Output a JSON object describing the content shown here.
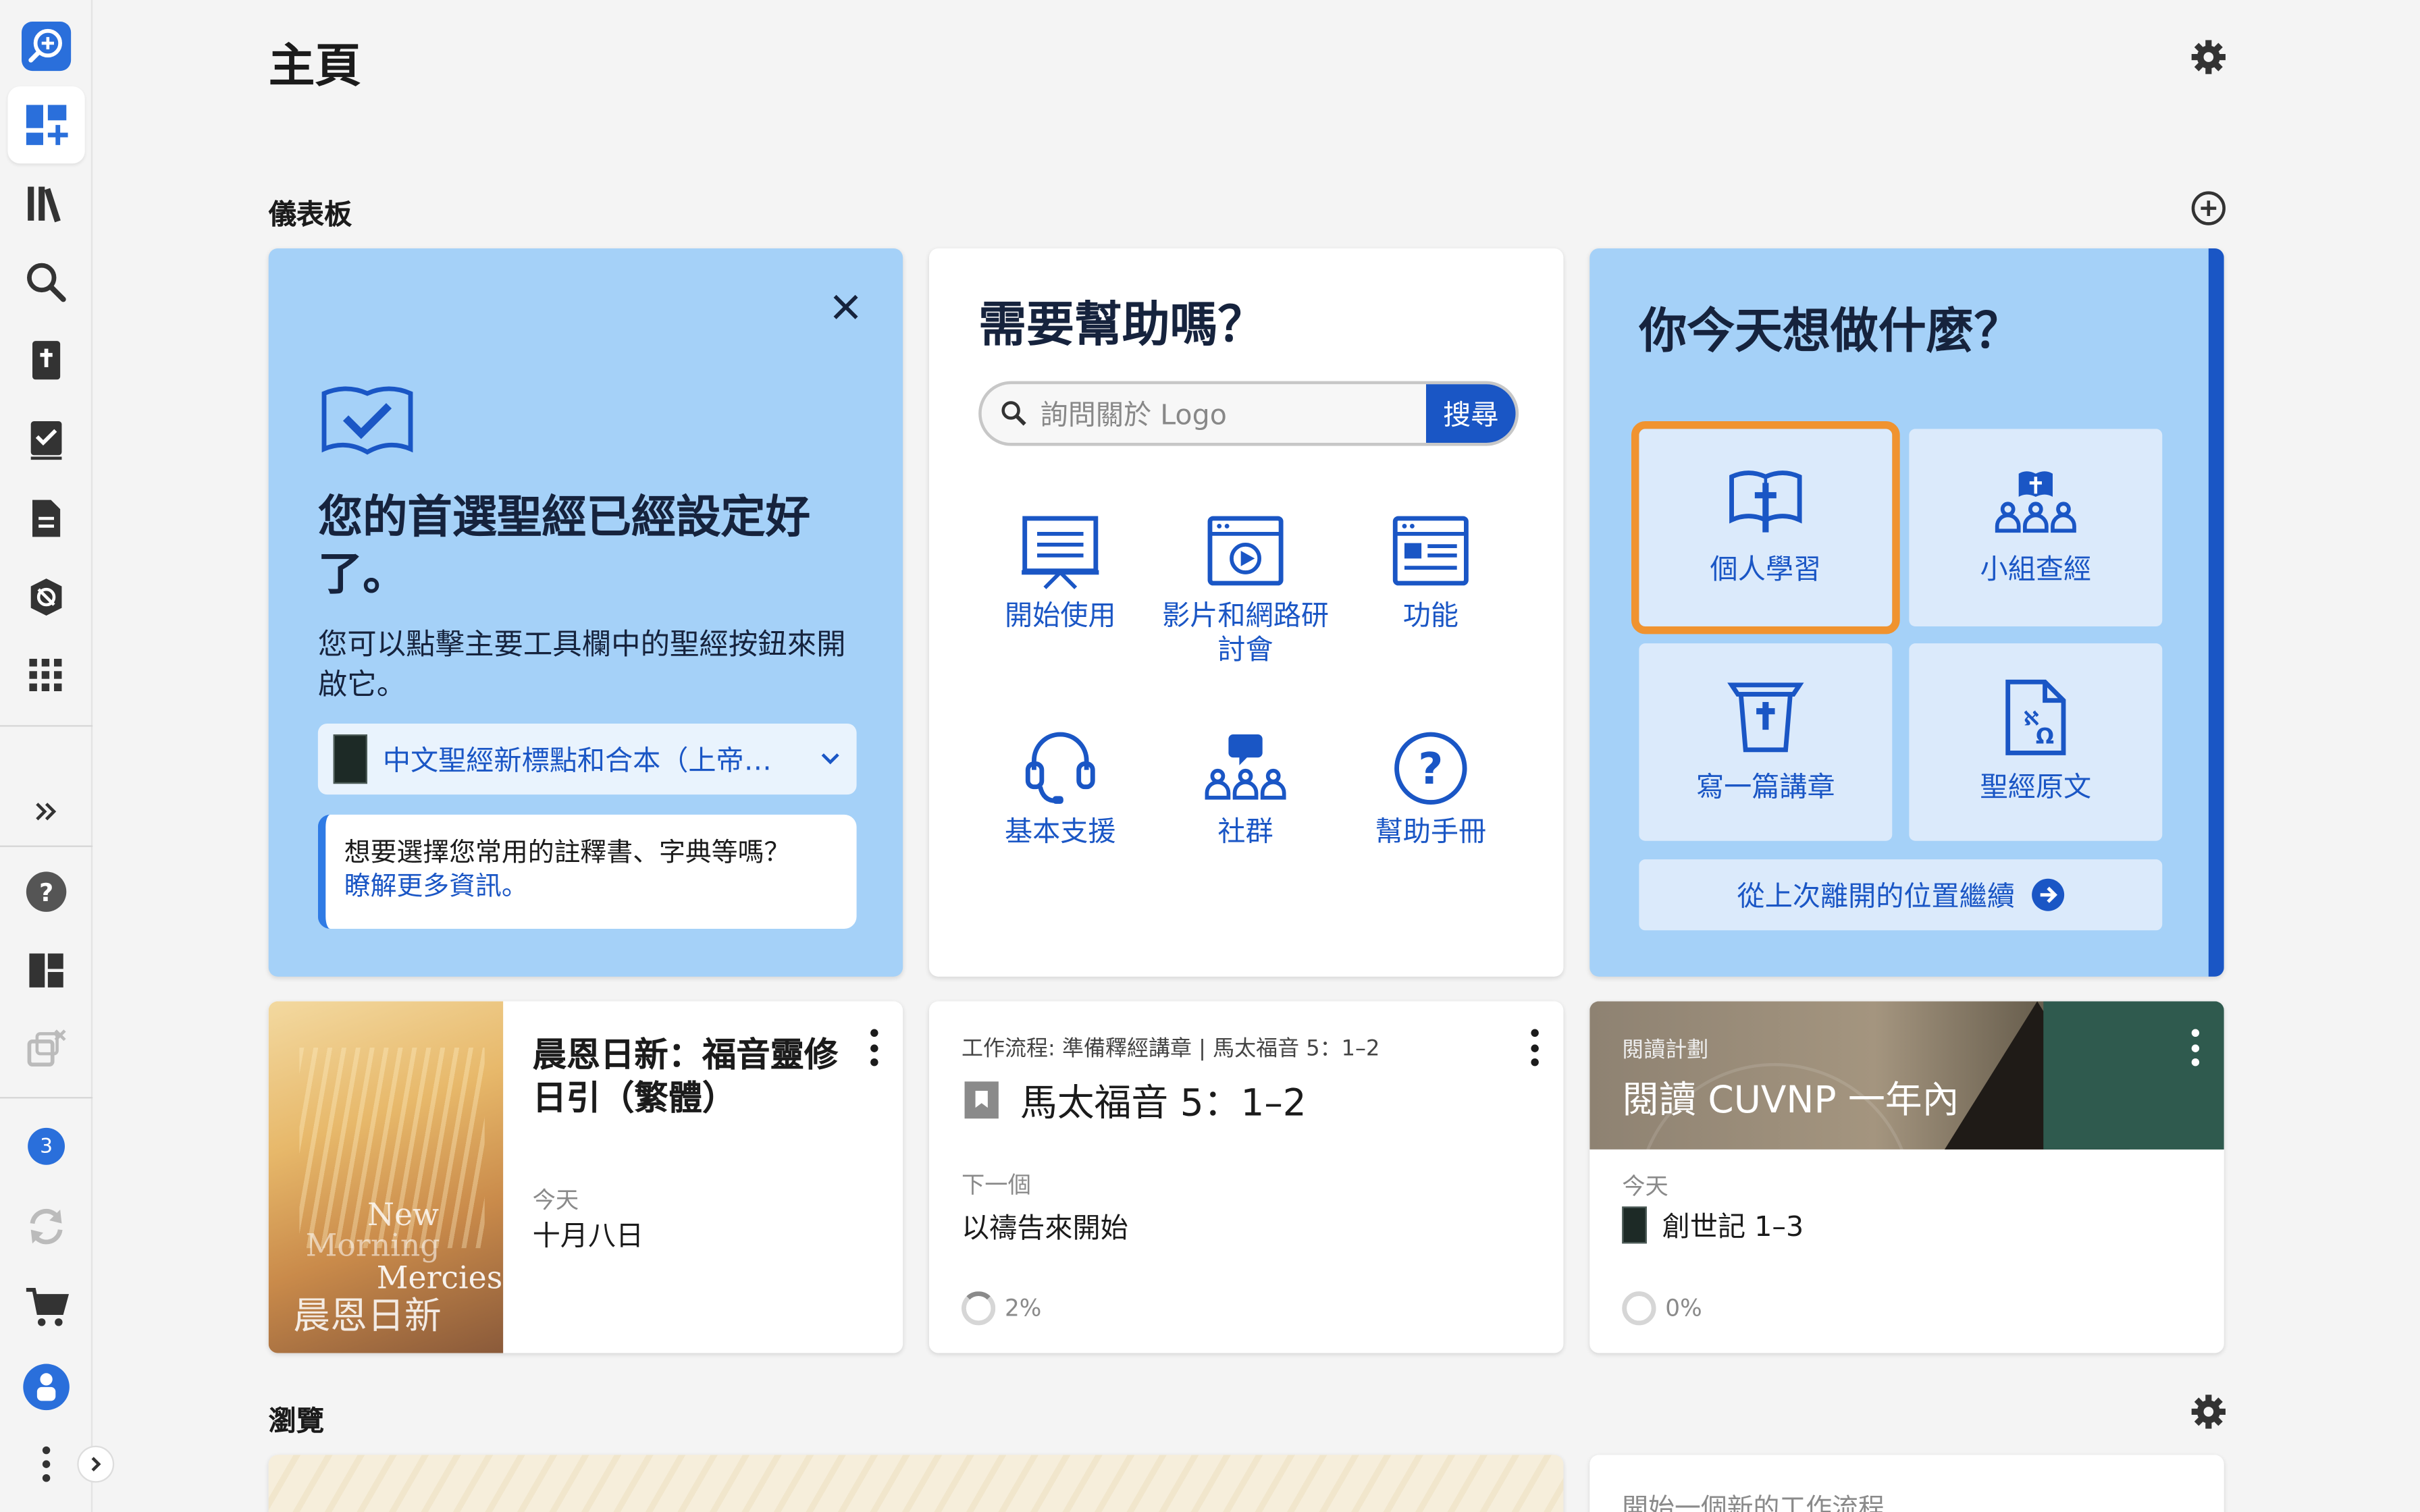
{
  "page": {
    "title": "主頁"
  },
  "sidebar": {
    "notification_count": "3"
  },
  "dashboard": {
    "section_title": "儀表板",
    "welcome_card": {
      "title": "您的首選聖經已經設定好了。",
      "description": "您可以點擊主要工具欄中的聖經按鈕來開啟它。",
      "bible_select_value": "中文聖經新標點和合本（上帝…",
      "tip_text": "想要選擇您常用的註釋書、字典等嗎？",
      "tip_link": "瞭解更多資訊。"
    },
    "help_card": {
      "title": "需要幫助嗎？",
      "search_placeholder": "詢問關於 Logo",
      "search_button": "搜尋",
      "items": [
        {
          "label": "開始使用"
        },
        {
          "label": "影片和網路研討會"
        },
        {
          "label": "功能"
        },
        {
          "label": "基本支援"
        },
        {
          "label": "社群"
        },
        {
          "label": "幫助手冊"
        }
      ]
    },
    "todo_card": {
      "title": "你今天想做什麼？",
      "tiles": [
        {
          "label": "個人學習"
        },
        {
          "label": "小組查經"
        },
        {
          "label": "寫一篇講章"
        },
        {
          "label": "聖經原文"
        }
      ],
      "continue_label": "從上次離開的位置繼續"
    },
    "devotional_card": {
      "title": "晨恩日新：福音靈修日引（繁體）",
      "date_label": "今天",
      "date_value": "十月八日",
      "cover_text_1": "New",
      "cover_text_2": "Morning",
      "cover_text_3": "Mercies",
      "cover_text_cn": "晨恩日新"
    },
    "workflow_card": {
      "subtitle": "工作流程: 準備釋經講章 | 馬太福音 5：1–2",
      "title": "馬太福音 5：1–2",
      "next_label": "下一個",
      "next_value": "以禱告來開始",
      "progress": "2%"
    },
    "reading_card": {
      "kicker": "閱讀計劃",
      "title": "閱讀 CUVNP 一年內",
      "date_label": "今天",
      "reading": "創世記 1–3",
      "progress": "0%"
    }
  },
  "browse": {
    "section_title": "瀏覽",
    "workflow_card_text": "開始一個新的工作流程"
  }
}
